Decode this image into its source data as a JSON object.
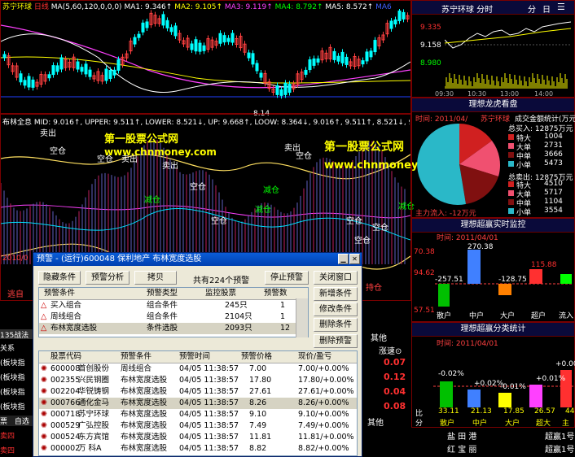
{
  "main_chart": {
    "title": "苏宁环球",
    "period": "日线",
    "ma_label": "MA(5,60,120,0,0,0)",
    "ma1": "MA1: 9.346↑",
    "ma2": "MA2: 9.105↑",
    "ma3": "MA3: 9.119↑",
    "ma4": "MA4: 8.792↑",
    "ma5": "MA5: 8.572↑",
    "ma6": "MA6",
    "low_price": "8.14",
    "boll_header": "布林全息  MID: 9.016↑, UPPER: 9.511↑, LOWER: 8.521↓, UP: 9.668↑, LOOW: 8.364↓, 9.016↑, 9.511↑, 8.521↓, 9.6",
    "date_label": "2010/0"
  },
  "signals": {
    "sell1": "卖出",
    "empty1": "空仓",
    "empty2": "空仓",
    "sell2": "卖出",
    "sell3": "卖出",
    "empty3": "空仓",
    "sell4": "卖出",
    "empty4": "空仓",
    "reduce1": "减仓",
    "reduce2": "减仓",
    "reduce3": "减仓",
    "reduce4": "减仓",
    "empty5": "空仓",
    "empty6": "空仓",
    "empty7": "空仓",
    "buy1": "逃自",
    "empty8": "空仓",
    "hold1": "持仓"
  },
  "watermark": {
    "cn1": "第一股票公式网",
    "url1": "www.chnmoney.com",
    "cn2": "第一股票公式网",
    "url2": "www.chnmoney.com"
  },
  "right_top": {
    "title": "苏宁环球  分时",
    "tab1": "分",
    "tab2": "日",
    "p1": "9.335",
    "p2": "9.158",
    "p3": "8.980",
    "t1": "09:30",
    "t2": "10:30",
    "t3": "13:00",
    "t4": "14:00"
  },
  "dragon": {
    "title": "理想龙虎看盘",
    "time_label": "时间: 2011/04/",
    "stock": "苏宁环球",
    "amount_title": "成交金额统计(万元",
    "total_buy": "总买入: 12875万元",
    "total_sell": "总卖出: 12875万元",
    "rows_buy": [
      {
        "k": "特大",
        "v": "1004"
      },
      {
        "k": "大单",
        "v": "2731"
      },
      {
        "k": "中单",
        "v": "3666"
      },
      {
        "k": "小单",
        "v": "5473"
      }
    ],
    "rows_sell": [
      {
        "k": "特大",
        "v": "4510"
      },
      {
        "k": "大单",
        "v": "5717"
      },
      {
        "k": "中单",
        "v": "1104"
      },
      {
        "k": "小单",
        "v": "3554"
      }
    ],
    "left_chars": [
      "卖",
      "卖",
      "卖",
      "卖",
      "买",
      "卖",
      "卖"
    ],
    "main_flow": "主力流入: -12万元",
    "colors": {
      "cyan": "#2ab8c8",
      "red": "#d02020",
      "pink": "#f05070",
      "dark": "#801010"
    }
  },
  "realtime": {
    "title": "理想超赢实时监控",
    "time_label": "时间: 2011/04/01",
    "values": [
      "-257.51",
      "270.38",
      "-128.75",
      "115.88"
    ],
    "axis": [
      "70.38",
      "94.62",
      "57.51"
    ],
    "labels": [
      "散户",
      "中户",
      "大户",
      "超户",
      "流入"
    ]
  },
  "classify": {
    "title": "理想超赢分类统计",
    "time_label": "时间: 2011/04/01",
    "pct": [
      "-0.02%",
      "+0.02%",
      "-0.01%",
      "+0.01%",
      "+0.00%"
    ],
    "row1": [
      "33.11",
      "21.13",
      "17.85",
      "26.57",
      "44"
    ],
    "row2": [
      "散户",
      "中户",
      "大户",
      "超大",
      "主力"
    ],
    "side": [
      "比",
      "分"
    ]
  },
  "bottom_right": {
    "c1": "盐 田 港",
    "c2": "超赢1号",
    "c3": "红 宝 丽",
    "c4": "超赢1号"
  },
  "left_strip": {
    "tab": "135战法",
    "header": "关系",
    "items": [
      "(板块指",
      "(板块指",
      "(板块指",
      "(板块指"
    ],
    "bottom": [
      "票",
      "卖四",
      "卖四"
    ],
    "tab2": "自选"
  },
  "mid_strip": {
    "other": "其他",
    "speed": "涨速⊙",
    "vals": [
      "0.07",
      "0.12",
      "0.04",
      "0.08"
    ],
    "other2": "其他"
  },
  "dialog": {
    "title": "预警 - (运行)600048 保利地产 布林宽度选股",
    "btn_hide": "隐藏条件",
    "btn_analysis": "预警分析",
    "btn_copy": "拷贝",
    "total": "共有224个预警",
    "btn_stop": "停止预警",
    "btn_close": "关闭窗口",
    "btn_new": "新增条件",
    "btn_edit": "修改条件",
    "btn_delete": "删除条件",
    "btn_delete_alert": "删除预警",
    "cond_headers": [
      "预警条件",
      "预警类型",
      "监控股票",
      "预警数"
    ],
    "conditions": [
      {
        "name": "买入组合",
        "type": "组合条件",
        "stocks": "245只",
        "count": "1"
      },
      {
        "name": "周线组合",
        "type": "组合条件",
        "stocks": "2104只",
        "count": "1"
      },
      {
        "name": "布林宽度选股",
        "type": "条件选股",
        "stocks": "2093只",
        "count": "12"
      }
    ],
    "alert_headers": [
      "股票代码",
      "预警条件",
      "预警时间",
      "预警价格",
      "现价/盈亏"
    ],
    "alerts": [
      {
        "code": "600008",
        "name": "首创股份",
        "cond": "周线组合",
        "time": "04/05 11:38:57",
        "price": "7.00",
        "now": "7.00/+0.00%"
      },
      {
        "code": "002355",
        "name": "兴民钢圈",
        "cond": "布林宽度选股",
        "time": "04/05 11:38:57",
        "price": "17.80",
        "now": "17.80/+0.00%"
      },
      {
        "code": "002204",
        "name": "华锐铸钢",
        "cond": "布林宽度选股",
        "time": "04/05 11:38:57",
        "price": "27.61",
        "now": "27.61/+0.00%"
      },
      {
        "code": "000766",
        "name": "通化金马",
        "cond": "布林宽度选股",
        "time": "04/05 11:38:57",
        "price": "8.26",
        "now": "8.26/+0.00%"
      },
      {
        "code": "000718",
        "name": "苏宁环球",
        "cond": "布林宽度选股",
        "time": "04/05 11:38:57",
        "price": "9.10",
        "now": "9.10/+0.00%"
      },
      {
        "code": "000529",
        "name": "广弘控股",
        "cond": "布林宽度选股",
        "time": "04/05 11:38:57",
        "price": "7.49",
        "now": "7.49/+0.00%"
      },
      {
        "code": "000524",
        "name": "东方宾馆",
        "cond": "布林宽度选股",
        "time": "04/05 11:38:57",
        "price": "11.81",
        "now": "11.81/+0.00%"
      },
      {
        "code": "000002",
        "name": "万  科A",
        "cond": "布林宽度选股",
        "time": "04/05 11:38:57",
        "price": "8.82",
        "now": "8.82/+0.00%"
      }
    ]
  }
}
